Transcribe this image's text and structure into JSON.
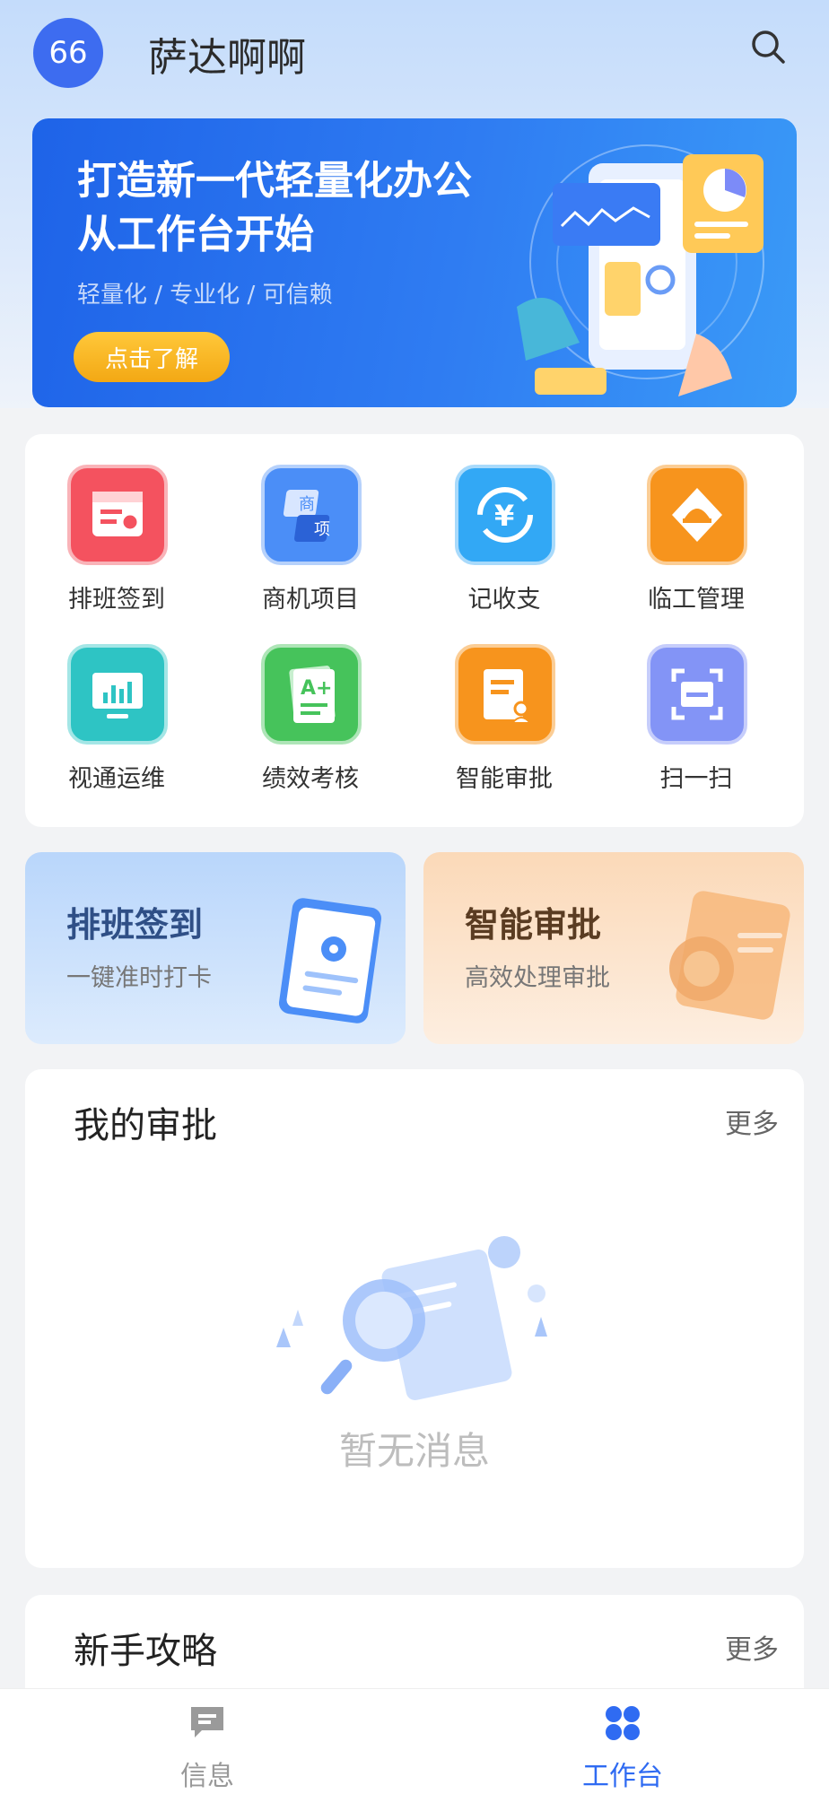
{
  "header": {
    "avatar_text": "66",
    "company_name": "萨达啊啊",
    "search_icon": "search-icon"
  },
  "banner": {
    "title_line1": "打造新一代轻量化办公",
    "title_line2": "从工作台开始",
    "subtitle": "轻量化 / 专业化 / 可信赖",
    "button_label": "点击了解"
  },
  "apps": [
    {
      "label": "排班签到",
      "icon": "calendar-location-icon",
      "color": "#f4525f"
    },
    {
      "label": "商机项目",
      "icon": "business-project-icon",
      "color": "#4b8ef7"
    },
    {
      "label": "记收支",
      "icon": "yuan-cycle-icon",
      "color": "#32a8f5"
    },
    {
      "label": "临工管理",
      "icon": "worker-helmet-icon",
      "color": "#f7941d"
    },
    {
      "label": "视通运维",
      "icon": "monitor-chart-icon",
      "color": "#2ec4c4"
    },
    {
      "label": "绩效考核",
      "icon": "grade-a-plus-icon",
      "color": "#46c35b"
    },
    {
      "label": "智能审批",
      "icon": "approval-document-icon",
      "color": "#f7941d"
    },
    {
      "label": "扫一扫",
      "icon": "scan-icon",
      "color": "#8394f6"
    }
  ],
  "promos": [
    {
      "title": "排班签到",
      "subtitle": "一键准时打卡",
      "icon": "location-card-icon"
    },
    {
      "title": "智能审批",
      "subtitle": "高效处理审批",
      "icon": "approval-folder-icon"
    }
  ],
  "approval_section": {
    "title": "我的审批",
    "more": "更多",
    "empty_text": "暂无消息"
  },
  "guide_section": {
    "title": "新手攻略",
    "more": "更多"
  },
  "tabbar": [
    {
      "label": "信息",
      "icon": "chat-bubble-icon",
      "active": false
    },
    {
      "label": "工作台",
      "icon": "grid-icon",
      "active": true
    }
  ],
  "colors": {
    "accent": "#3d6cf0",
    "tab_active": "#2f6bf2",
    "tab_inactive": "#999999"
  }
}
